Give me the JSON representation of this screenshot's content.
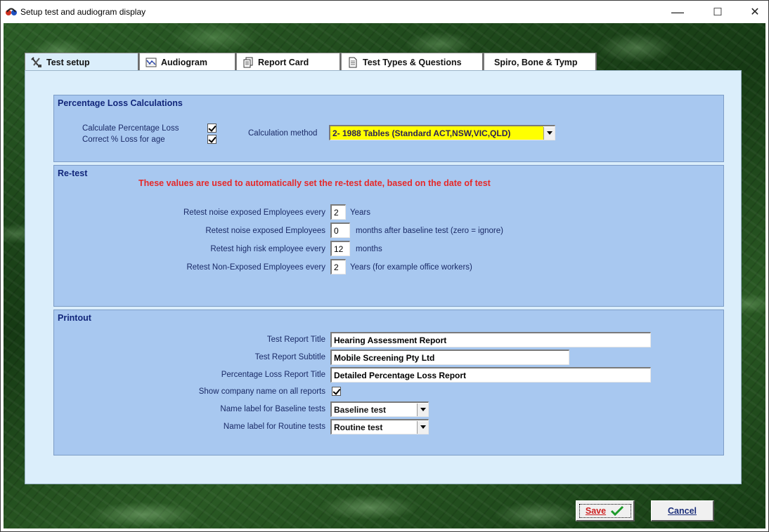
{
  "window": {
    "title": "Setup test and audiogram display",
    "controls": {
      "minimize": "—",
      "maximize": "☐",
      "close": "✕"
    }
  },
  "tabs": [
    {
      "label": "Test setup",
      "icon": "tools-icon",
      "active": true
    },
    {
      "label": "Audiogram",
      "icon": "audiogram-chart-icon",
      "active": false
    },
    {
      "label": "Report Card",
      "icon": "report-card-icon",
      "active": false
    },
    {
      "label": "Test Types & Questions",
      "icon": "document-icon",
      "active": false
    },
    {
      "label": "Spiro, Bone & Tymp",
      "icon": "",
      "active": false
    }
  ],
  "percentage_loss": {
    "title": "Percentage Loss Calculations",
    "calculate_label": "Calculate Percentage Loss",
    "calculate_checked": true,
    "age_label": "Correct % Loss for age",
    "age_checked": true,
    "method_label": "Calculation method",
    "method_value": "2- 1988 Tables (Standard ACT,NSW,VIC,QLD)"
  },
  "retest": {
    "title": "Re-test",
    "note": "These values are used to automatically set the re-test date, based on the date of test",
    "rows": [
      {
        "label": "Retest noise exposed Employees every",
        "value": "2",
        "suffix": "Years"
      },
      {
        "label": "Retest noise exposed Employees",
        "value": "0",
        "suffix": "months after baseline test   (zero = ignore)"
      },
      {
        "label": "Retest high risk employee every",
        "value": "12",
        "suffix": "months"
      },
      {
        "label": "Retest Non-Exposed Employees every",
        "value": "2",
        "suffix": "Years     (for example office workers)"
      }
    ]
  },
  "printout": {
    "title": "Printout",
    "report_title_label": "Test Report Title",
    "report_title_value": "Hearing Assessment Report",
    "report_subtitle_label": "Test Report Subtitle",
    "report_subtitle_value": "Mobile Screening Pty Ltd",
    "pct_title_label": "Percentage Loss Report Title",
    "pct_title_value": "Detailed Percentage Loss Report",
    "show_company_label": "Show company name on all reports",
    "show_company_checked": true,
    "baseline_label": "Name label for Baseline tests",
    "baseline_value": "Baseline test",
    "routine_label": "Name label for Routine tests",
    "routine_value": "Routine test"
  },
  "buttons": {
    "save": "Save",
    "cancel": "Cancel"
  },
  "colors": {
    "panel": "#a8c8f0",
    "page": "#dbeefb",
    "heading": "#11267a",
    "note": "#e62828",
    "highlight": "#ffff00"
  }
}
